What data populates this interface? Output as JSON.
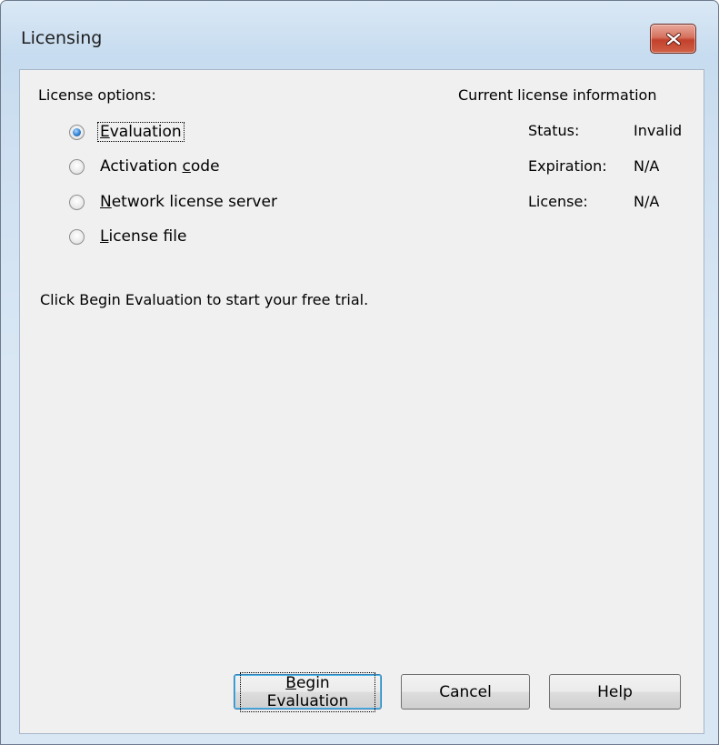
{
  "window": {
    "title": "Licensing"
  },
  "license_options": {
    "heading": "License options:",
    "options": [
      {
        "mnemonic": "E",
        "rest": "valuation",
        "checked": true
      },
      {
        "pre": "Activation ",
        "mnemonic": "c",
        "rest": "ode",
        "checked": false
      },
      {
        "mnemonic": "N",
        "rest": "etwork license server",
        "checked": false
      },
      {
        "mnemonic": "L",
        "rest": "icense file",
        "checked": false
      }
    ]
  },
  "current_info": {
    "heading": "Current license information",
    "status_label": "Status:",
    "status_value": "Invalid",
    "expiration_label": "Expiration:",
    "expiration_value": "N/A",
    "license_label": "License:",
    "license_value": "N/A"
  },
  "hint": "Click Begin Evaluation to start your free trial.",
  "buttons": {
    "begin_mnemonic": "B",
    "begin_rest": "egin Evaluation",
    "cancel": "Cancel",
    "help": "Help"
  },
  "colors": {
    "close_button": "#c2412c",
    "radio_checked": "#2f7fd1",
    "default_button_border": "#3c7fb1"
  }
}
